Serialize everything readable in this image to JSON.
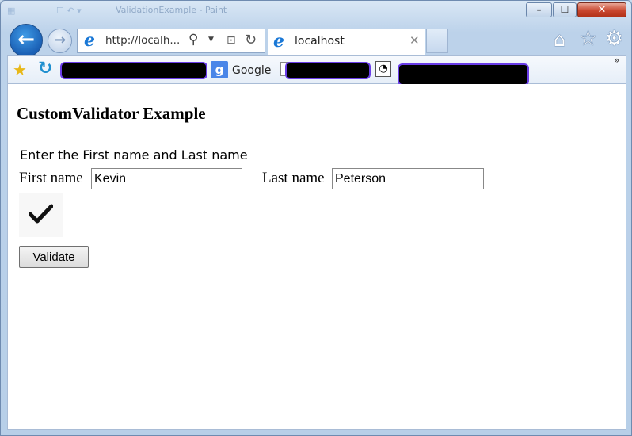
{
  "window": {
    "title": "ValidationExample - Paint"
  },
  "nav": {
    "address_url": "http://localh...",
    "tab_label": "localhost",
    "tab_close_glyph": "✕"
  },
  "favorites": {
    "google_label": "Google"
  },
  "page": {
    "heading": "CustomValidator Example",
    "instruction": "Enter the First name and Last name",
    "first_name_label": "First name",
    "first_name_value": "Kevin",
    "last_name_label": "Last name",
    "last_name_value": "Peterson",
    "validate_label": "Validate"
  },
  "icons": {
    "back": "arrow-left-icon",
    "forward": "arrow-right-icon",
    "home": "home-icon",
    "favorites": "star-icon",
    "tools": "gear-icon",
    "valid": "checkmark-icon"
  },
  "colors": {
    "window_frame": "#bcd2ea",
    "back_button": "#1a5fb4",
    "close_button": "#c9472f",
    "redaction": "#000000",
    "redaction_outline": "#6a3de8",
    "google_icon": "#4a86e8"
  }
}
